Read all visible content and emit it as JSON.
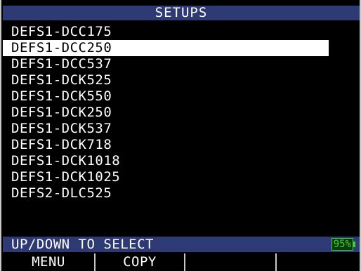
{
  "header": {
    "title": "SETUPS"
  },
  "setups": {
    "items": [
      {
        "label": "DEFS1-DCC175",
        "selected": false
      },
      {
        "label": "DEFS1-DCC250",
        "selected": true
      },
      {
        "label": "DEFS1-DCC537",
        "selected": false
      },
      {
        "label": "DEFS1-DCK525",
        "selected": false
      },
      {
        "label": "DEFS1-DCK550",
        "selected": false
      },
      {
        "label": "DEFS1-DCK250",
        "selected": false
      },
      {
        "label": "DEFS1-DCK537",
        "selected": false
      },
      {
        "label": "DEFS1-DCK718",
        "selected": false
      },
      {
        "label": "DEFS1-DCK1018",
        "selected": false
      },
      {
        "label": "DEFS1-DCK1025",
        "selected": false
      },
      {
        "label": "DEFS2-DLC525",
        "selected": false
      }
    ]
  },
  "status": {
    "message": "UP/DOWN TO SELECT",
    "battery_label": "95%",
    "battery_level": 95
  },
  "softkeys": [
    {
      "label": "MENU"
    },
    {
      "label": "COPY"
    },
    {
      "label": ""
    },
    {
      "label": ""
    }
  ],
  "colors": {
    "bar_background": "#2e3a74",
    "battery": "#3cd13c",
    "selection": "#ffffff"
  }
}
